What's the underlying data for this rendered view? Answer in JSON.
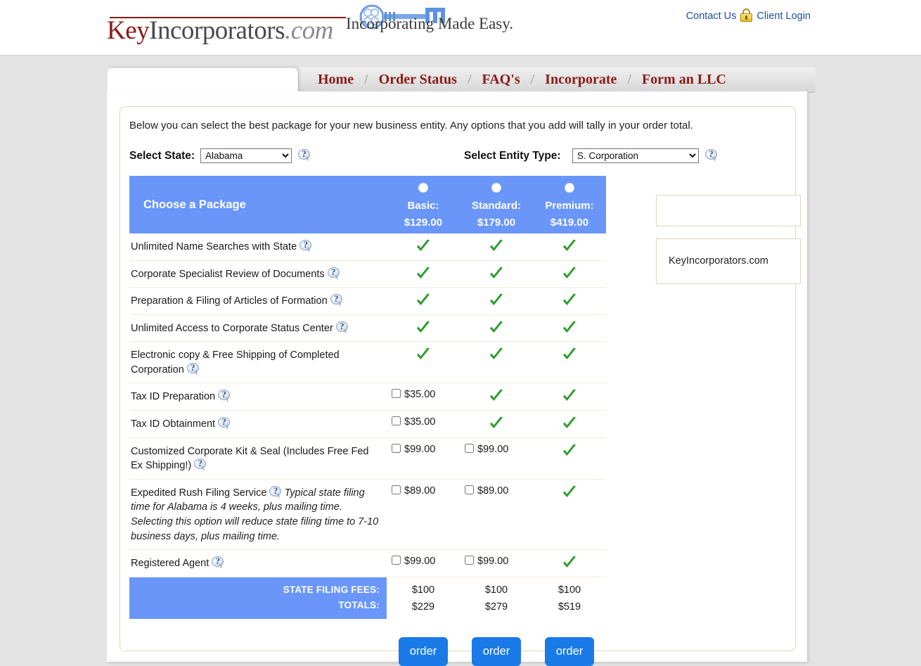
{
  "header": {
    "logo": {
      "part1": "Key",
      "part2": "Incorporators",
      "part3": ".com",
      "key_icon": "key-icon"
    },
    "tagline": "Incorporating Made Easy.",
    "contact_link": "Contact Us",
    "lock_icon": "lock-icon",
    "client_login_link": "Client Login"
  },
  "nav": {
    "separator": "/",
    "items": [
      {
        "label": "Home"
      },
      {
        "label": "Order Status"
      },
      {
        "label": "FAQ's"
      },
      {
        "label": "Incorporate"
      },
      {
        "label": "Form an LLC"
      }
    ]
  },
  "main": {
    "intro": "Below you can select the best package for your new business entity. Any options that you add will tally in your order total.",
    "state_label": "Select State:",
    "state_value": "Alabama",
    "state_options": [
      "Alabama"
    ],
    "entity_label": "Select Entity Type:",
    "entity_value": "S. Corporation",
    "entity_options": [
      "S. Corporation"
    ],
    "help_icon": "help-icon",
    "table_title": "Choose a Package",
    "packages": [
      {
        "name": "Basic:",
        "price": "$129.00",
        "radio": "radio-basic"
      },
      {
        "name": "Standard:",
        "price": "$179.00",
        "radio": "radio-standard"
      },
      {
        "name": "Premium:",
        "price": "$419.00",
        "radio": "radio-premium"
      }
    ],
    "features": [
      {
        "label": "Unlimited Name Searches with State",
        "cells": [
          {
            "type": "check"
          },
          {
            "type": "check"
          },
          {
            "type": "check"
          }
        ]
      },
      {
        "label": "Corporate Specialist Review of Documents",
        "cells": [
          {
            "type": "check"
          },
          {
            "type": "check"
          },
          {
            "type": "check"
          }
        ]
      },
      {
        "label": "Preparation & Filing of Articles of Formation",
        "cells": [
          {
            "type": "check"
          },
          {
            "type": "check"
          },
          {
            "type": "check"
          }
        ]
      },
      {
        "label": "Unlimited Access to Corporate Status Center",
        "cells": [
          {
            "type": "check"
          },
          {
            "type": "check"
          },
          {
            "type": "check"
          }
        ]
      },
      {
        "label": "Electronic copy & Free Shipping of Completed Corporation",
        "cells": [
          {
            "type": "check"
          },
          {
            "type": "check"
          },
          {
            "type": "check"
          }
        ]
      },
      {
        "label": "Tax ID Preparation",
        "cells": [
          {
            "type": "checkbox",
            "price": "$35.00",
            "checked": false
          },
          {
            "type": "check"
          },
          {
            "type": "check"
          }
        ]
      },
      {
        "label": "Tax ID Obtainment",
        "cells": [
          {
            "type": "checkbox",
            "price": "$35.00",
            "checked": false
          },
          {
            "type": "check"
          },
          {
            "type": "check"
          }
        ]
      },
      {
        "label": "Customized Corporate Kit & Seal (Includes Free Fed Ex Shipping!)",
        "cells": [
          {
            "type": "checkbox",
            "price": "$99.00",
            "checked": false
          },
          {
            "type": "checkbox",
            "price": "$99.00",
            "checked": false
          },
          {
            "type": "check"
          }
        ]
      },
      {
        "label": "Expedited Rush Filing Service",
        "note": "Typical state filing time for Alabama is 4 weeks, plus mailing time. Selecting this option will reduce state filing time to 7-10 business days, plus mailing time.",
        "cells": [
          {
            "type": "checkbox",
            "price": "$89.00",
            "checked": false
          },
          {
            "type": "checkbox",
            "price": "$89.00",
            "checked": false
          },
          {
            "type": "check"
          }
        ]
      },
      {
        "label": "Registered Agent",
        "cells": [
          {
            "type": "checkbox",
            "price": "$99.00",
            "checked": false
          },
          {
            "type": "checkbox",
            "price": "$99.00",
            "checked": false
          },
          {
            "type": "check"
          }
        ]
      }
    ],
    "state_filing_fees_label": "STATE FILING FEES:",
    "totals_label": "TOTALS:",
    "state_filing_fees": [
      "$100",
      "$100",
      "$100"
    ],
    "totals": [
      "$229",
      "$279",
      "$519"
    ],
    "order_label": "order"
  },
  "sidebar": {
    "box_two_text": "KeyIncorporators.com"
  },
  "colors": {
    "page_background": "#e4e4e4",
    "table_header_blue": "#6a96fa",
    "order_button_blue": "#1a7ae8",
    "nav_link_red": "#8c1a16",
    "link_blue": "#1d4f9e",
    "check_green": "#2e9b2e",
    "border_beige": "#ded8bd"
  }
}
